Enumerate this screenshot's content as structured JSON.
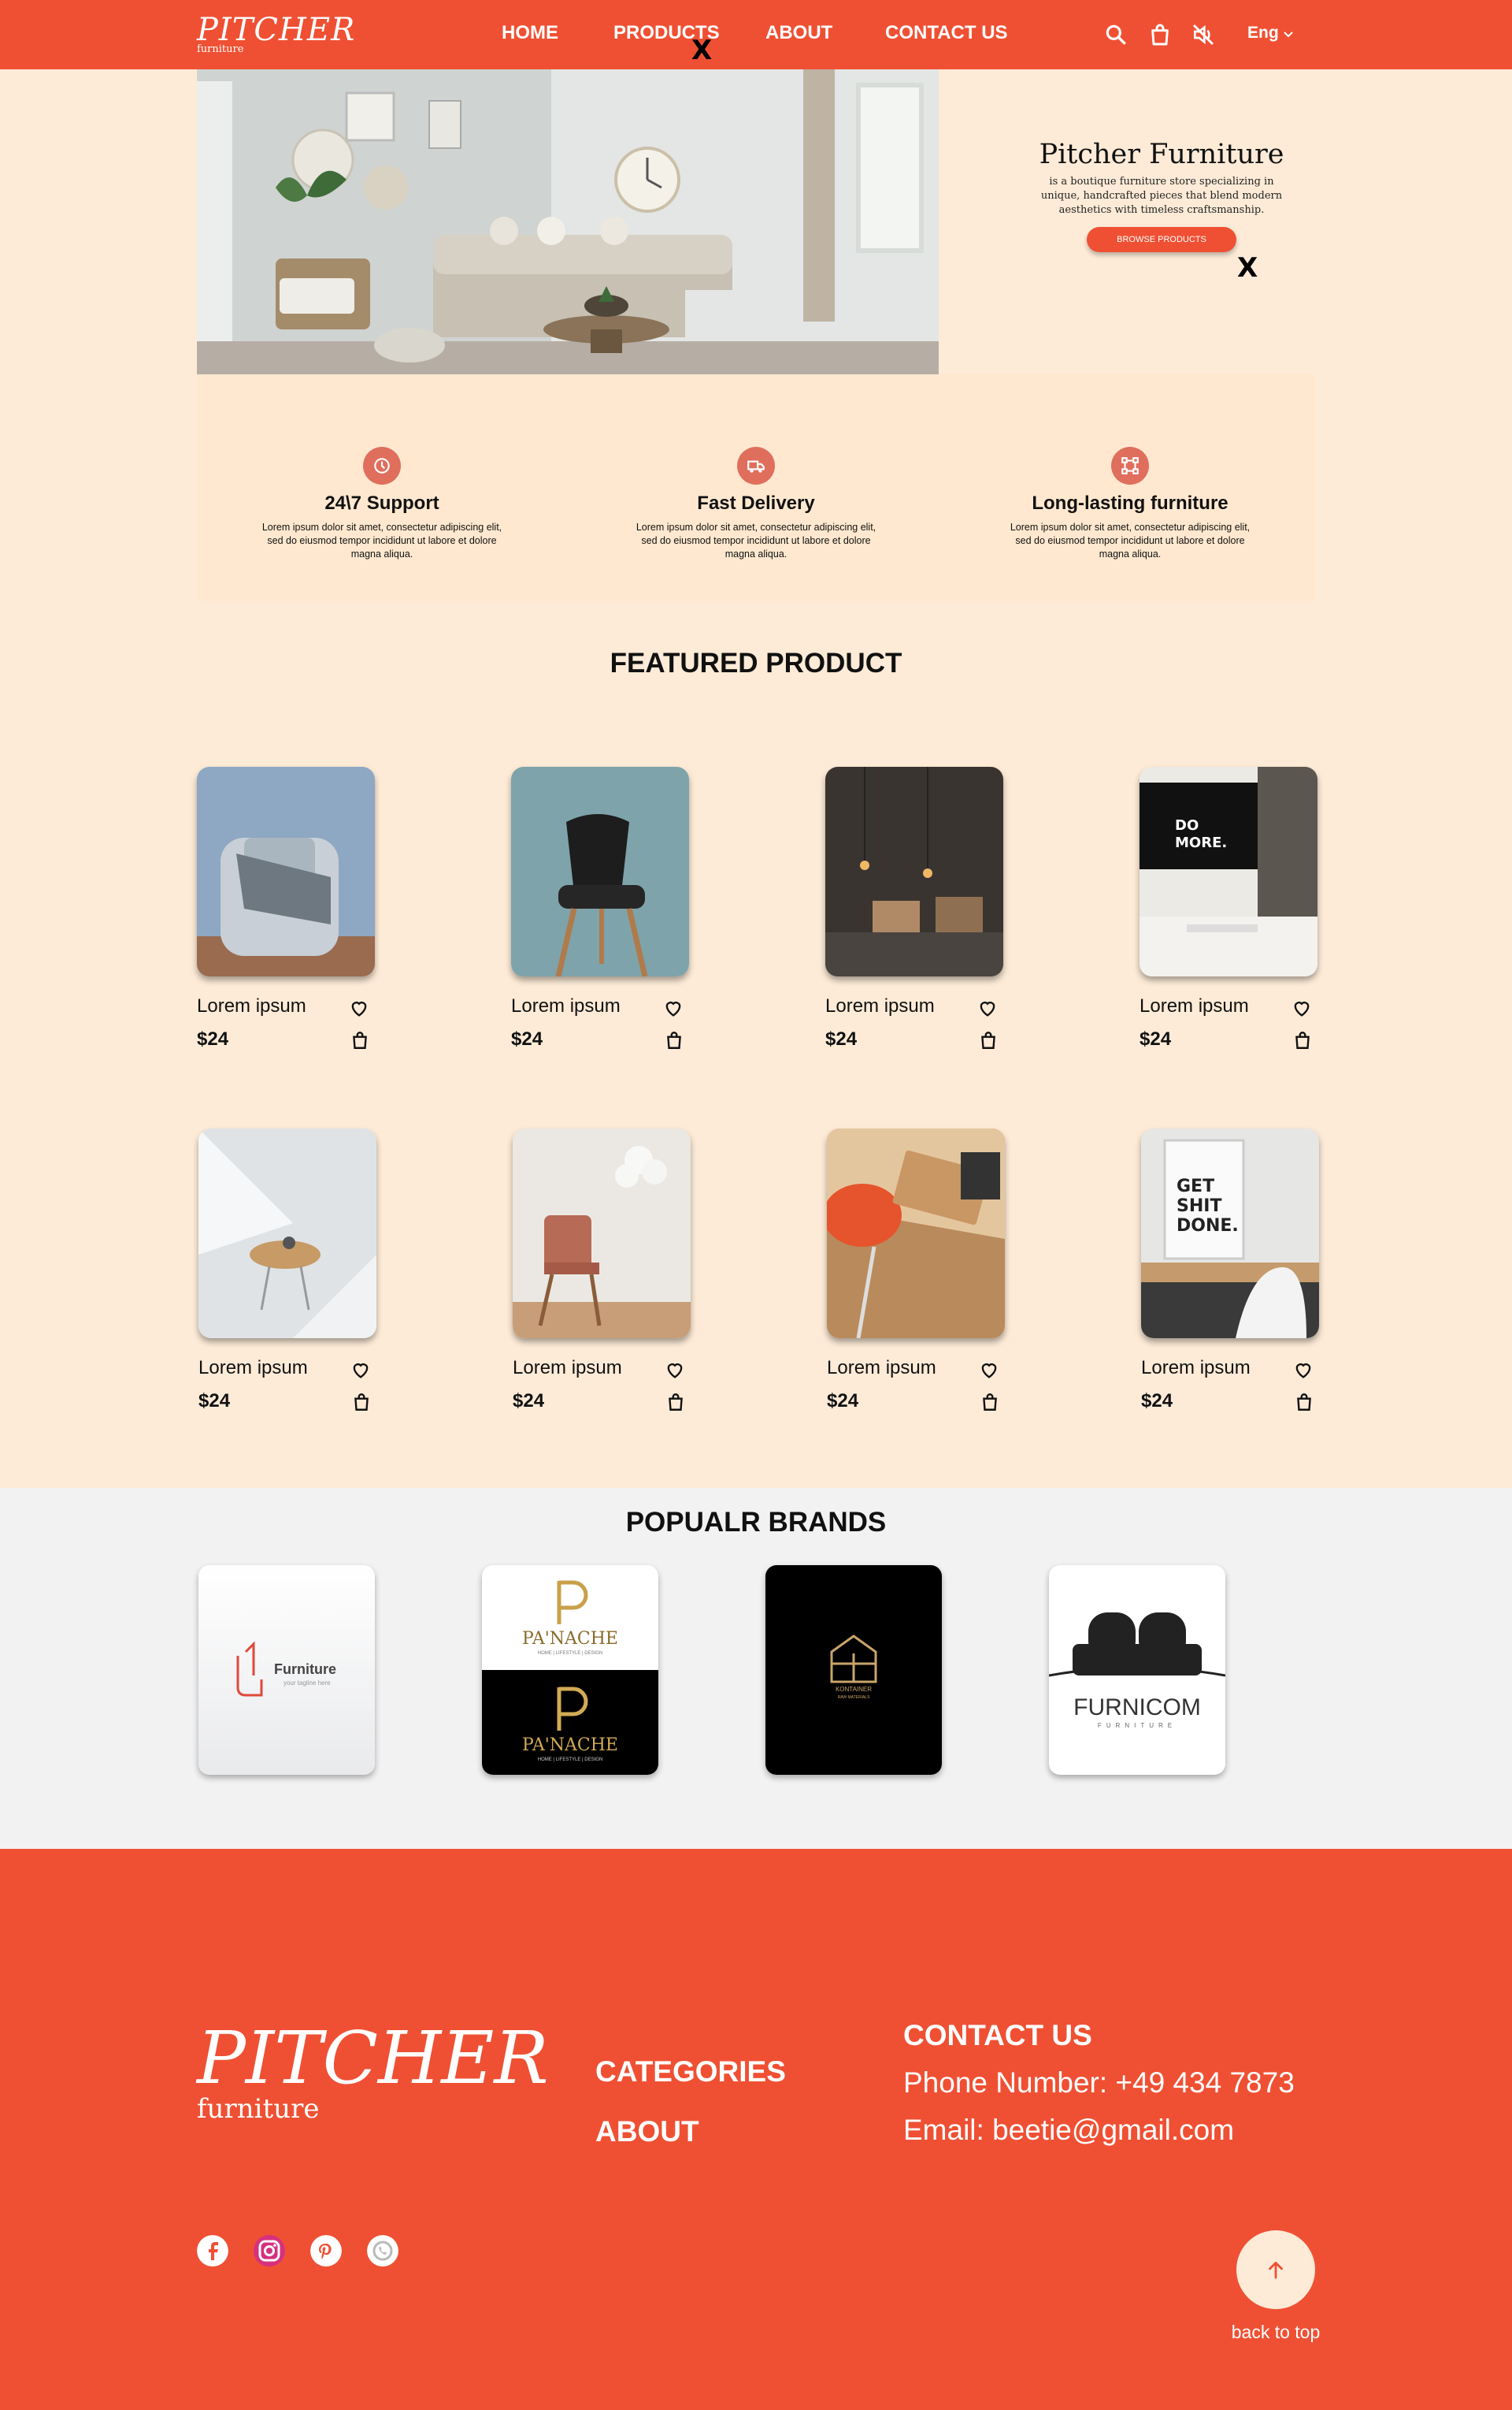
{
  "nav": {
    "logo_main": "PITCHER",
    "logo_sub": "furniture",
    "links": [
      "HOME",
      "PRODUCTS",
      "ABOUT",
      "CONTACT US"
    ],
    "icons": [
      "search-icon",
      "shopping-bag-icon",
      "mute-icon"
    ],
    "language": "Eng",
    "close_mark": "X"
  },
  "hero": {
    "title": "Pitcher Furniture",
    "description": "is a boutique furniture store specializing in unique, handcrafted pieces that blend modern aesthetics with timeless craftsmanship.",
    "button_label": "BROWSE PRODUCTS",
    "close_mark": "X"
  },
  "features": [
    {
      "icon": "clock-support-icon",
      "title": "24\\7 Support",
      "desc": "Lorem ipsum dolor sit amet, consectetur adipiscing elit, sed do eiusmod tempor incididunt ut labore et dolore magna aliqua."
    },
    {
      "icon": "delivery-truck-icon",
      "title": "Fast Delivery",
      "desc": "Lorem ipsum dolor sit amet, consectetur adipiscing elit, sed do eiusmod tempor incididunt ut labore et dolore magna aliqua."
    },
    {
      "icon": "frame-icon",
      "title": "Long-lasting furniture",
      "desc": "Lorem ipsum dolor sit amet, consectetur adipiscing elit, sed do eiusmod tempor incididunt ut labore et dolore magna aliqua."
    }
  ],
  "featured": {
    "title": "FEATURED PRODUCT",
    "products": [
      {
        "name": "Lorem ipsum",
        "price": "$24"
      },
      {
        "name": "Lorem ipsum",
        "price": "$24"
      },
      {
        "name": "Lorem ipsum",
        "price": "$24"
      },
      {
        "name": "Lorem ipsum",
        "price": "$24"
      },
      {
        "name": "Lorem ipsum",
        "price": "$24"
      },
      {
        "name": "Lorem ipsum",
        "price": "$24"
      },
      {
        "name": "Lorem ipsum",
        "price": "$24"
      },
      {
        "name": "Lorem ipsum",
        "price": "$24"
      }
    ]
  },
  "brands": {
    "title": "POPUALR BRANDS",
    "items": [
      {
        "name": "Furniture",
        "tagline": "your tagline here"
      },
      {
        "name": "PA'NACHE",
        "tagline": "HOME | LIFESTYLE | DESIGN"
      },
      {
        "name": "KONTAINER",
        "tagline": "RAW MATERIALS"
      },
      {
        "name": "FURNICOM",
        "tagline": "FURNITURE"
      }
    ]
  },
  "footer": {
    "logo_main": "PITCHER",
    "logo_sub": "furniture",
    "links": [
      "CATEGORIES",
      "ABOUT"
    ],
    "contact_title": "CONTACT US",
    "phone": "Phone Number: +49 434 7873",
    "email": "Email: beetie@gmail.com",
    "socials": [
      "facebook-icon",
      "instagram-icon",
      "pinterest-icon",
      "whatsapp-icon"
    ],
    "back_to_top": "back to top"
  },
  "colors": {
    "accent": "#ef5033",
    "background": "#fdebd7",
    "features_bg": "#ffe8cf",
    "brands_bg": "#f2f2f2"
  }
}
